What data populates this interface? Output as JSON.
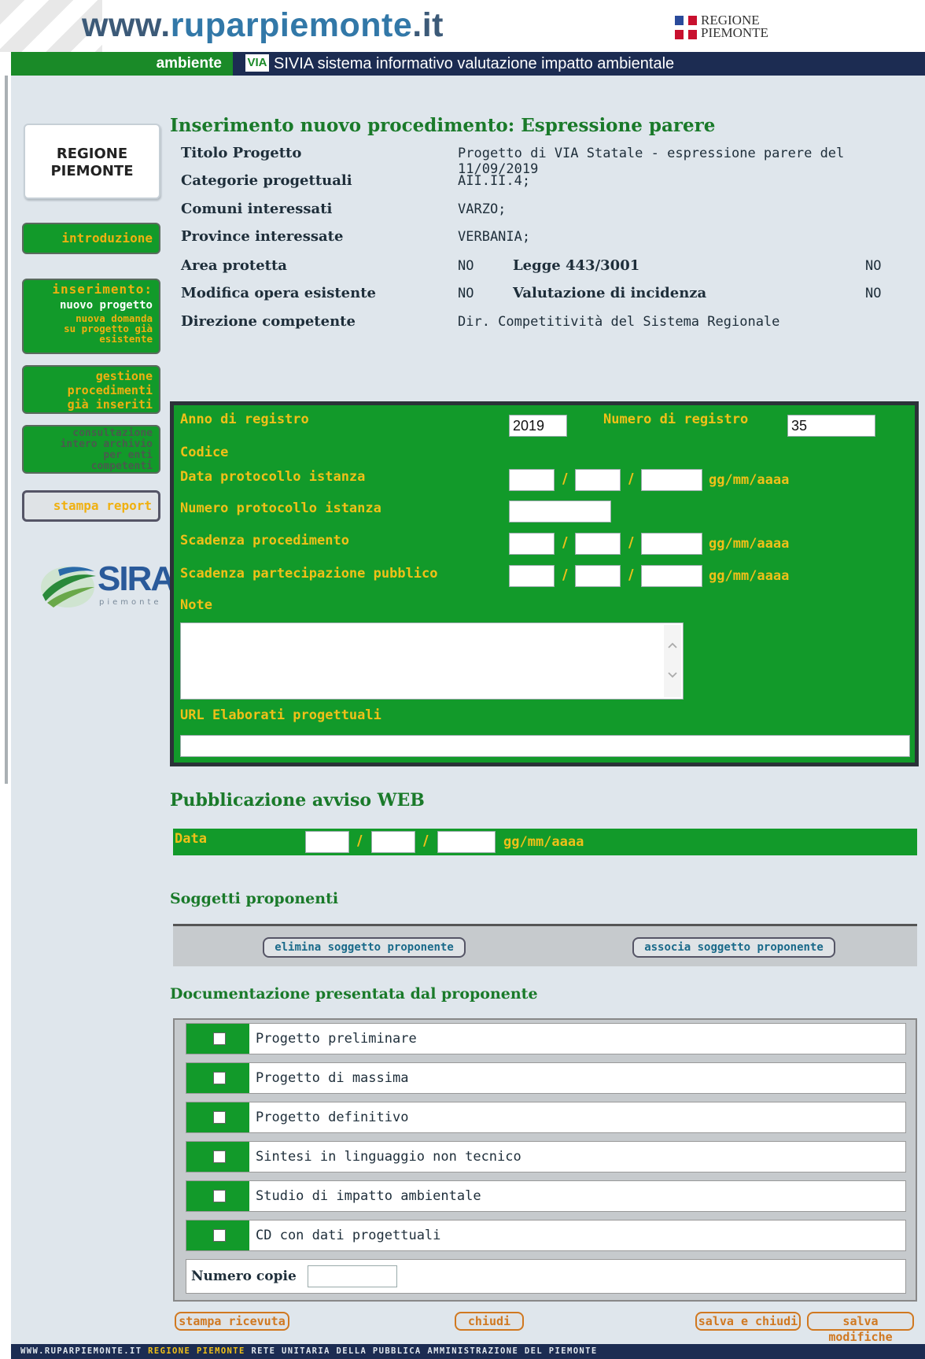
{
  "header": {
    "site_title_part1": "www.",
    "site_title_part2": "ruparpiemonte",
    "site_title_part3": ".it",
    "regione_logo_line1": "REGIONE",
    "regione_logo_line2": "PIEMONTE",
    "ambiente_label": "ambiente",
    "via_logo": "VIA",
    "sivia_title": "SIVIA sistema informativo valutazione impatto ambientale"
  },
  "sidebar": {
    "regione_line1": "REGIONE",
    "regione_line2": "PIEMONTE",
    "nav_introduzione": "introduzione",
    "nav_inserimento_title": "inserimento:",
    "nav_inserimento_sub1": "nuovo progetto",
    "nav_inserimento_sub2a": "nuova domanda",
    "nav_inserimento_sub2b": "su progetto già",
    "nav_inserimento_sub2c": "esistente",
    "nav_gestione_1": "gestione",
    "nav_gestione_2": "procedimenti",
    "nav_gestione_3": "già inseriti",
    "nav_consultazione_1": "consultazione",
    "nav_consultazione_2": "intero archivio",
    "nav_consultazione_3": "per enti",
    "nav_consultazione_4": "competenti",
    "nav_stampa_report": "stampa report",
    "sira_logo_text": "SIRA",
    "sira_logo_sub": "piemonte"
  },
  "page_title": "Inserimento nuovo procedimento: Espressione parere",
  "info": {
    "titolo_label": "Titolo Progetto",
    "titolo_value": "Progetto di VIA Statale - espressione parere del 11/09/2019",
    "categorie_label": "Categorie progettuali",
    "categorie_value": "AII.II.4;",
    "comuni_label": "Comuni interessati",
    "comuni_value": "VARZO;",
    "province_label": "Province interessate",
    "province_value": "VERBANIA;",
    "area_label": "Area protetta",
    "area_value": "NO",
    "legge_label": "Legge 443/3001",
    "legge_value": "NO",
    "modifica_label": "Modifica opera esistente",
    "modifica_value": "NO",
    "incidenza_label": "Valutazione di incidenza",
    "incidenza_value": "NO",
    "direzione_label": "Direzione competente",
    "direzione_value": "Dir. Competitività del Sistema Regionale"
  },
  "form": {
    "anno_label": "Anno di registro",
    "anno_value": "2019",
    "numero_label": "Numero di registro",
    "numero_value": "35",
    "codice_label": "Codice",
    "data_protocollo_label": "Data protocollo istanza",
    "numero_protocollo_label": "Numero protocollo istanza",
    "scadenza_proc_label": "Scadenza procedimento",
    "scadenza_pubbl_label": "Scadenza partecipazione pubblico",
    "note_label": "Note",
    "url_label": "URL Elaborati progettuali",
    "date_format": "gg/mm/aaaa",
    "date_sep": "/"
  },
  "web": {
    "title": "Pubblicazione avviso WEB",
    "data_label": "Data",
    "date_format": "gg/mm/aaaa"
  },
  "soggetti": {
    "title": "Soggetti proponenti",
    "elimina_button": "elimina soggetto proponente",
    "associa_button": "associa soggetto proponente"
  },
  "documentazione": {
    "title": "Documentazione presentata dal proponente",
    "items": [
      {
        "label": "Progetto preliminare",
        "checked": false
      },
      {
        "label": "Progetto di massima",
        "checked": false
      },
      {
        "label": "Progetto definitivo",
        "checked": false
      },
      {
        "label": "Sintesi in linguaggio non tecnico",
        "checked": false
      },
      {
        "label": "Studio di impatto ambientale",
        "checked": false
      },
      {
        "label": "CD con dati progettuali",
        "checked": false
      }
    ],
    "numero_copie_label": "Numero copie"
  },
  "actions": {
    "stampa_ricevuta": "stampa ricevuta",
    "chiudi": "chiudi",
    "salva_e_chiudi": "salva e chiudi",
    "salva_modifiche": "salva modifiche"
  },
  "footer": {
    "part1": "WWW.RUPARPIEMONTE.IT",
    "part2": "REGIONE PIEMONTE",
    "part3": "RETE UNITARIA DELLA PUBBLICA AMMINISTRAZIONE DEL PIEMONTE"
  },
  "colors": {
    "panel_green": "#129a2a",
    "label_orange": "#f0c018",
    "navy": "#1c2c52",
    "heading_green": "#1a7a2a"
  }
}
